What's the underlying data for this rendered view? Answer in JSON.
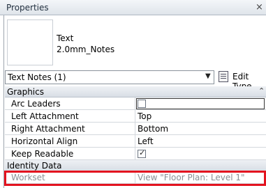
{
  "panel": {
    "title": "Properties",
    "close_icon": "close-icon"
  },
  "type": {
    "family": "Text",
    "name": "2.0mm_Notes"
  },
  "selector": {
    "label": "Text Notes (1)",
    "edit_type_label": "Edit Type"
  },
  "groups": {
    "graphics": "Graphics",
    "identity": "Identity Data"
  },
  "properties": [
    {
      "name": "Arc Leaders",
      "value": "",
      "kind": "checkbox",
      "checked": false
    },
    {
      "name": "Left Attachment",
      "value": "Top"
    },
    {
      "name": "Right Attachment",
      "value": "Bottom"
    },
    {
      "name": "Horizontal Align",
      "value": "Left"
    },
    {
      "name": "Keep Readable",
      "value": "",
      "kind": "checkbox",
      "checked": true
    }
  ],
  "identity": {
    "name": "Workset",
    "value": "View \"Floor Plan: Level 1\""
  },
  "colors": {
    "highlight": "#e3131f",
    "group_bg": "#dfe4ea"
  }
}
